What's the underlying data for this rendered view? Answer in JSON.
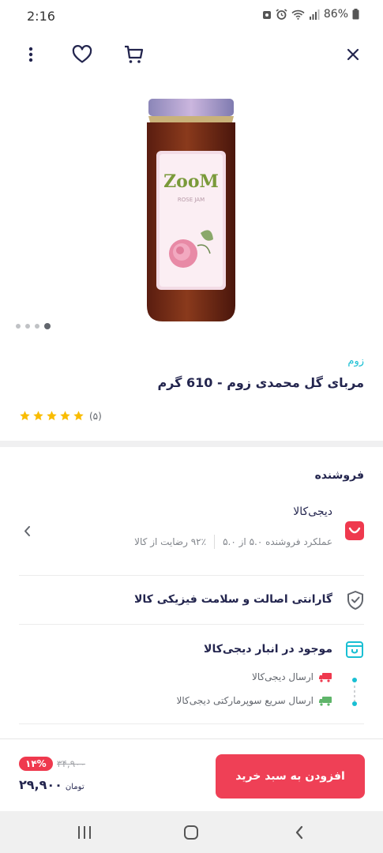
{
  "status_bar": {
    "time": "2:16",
    "battery": "86%"
  },
  "product": {
    "brand": "زوم",
    "title": "مربای گل محمدی زوم - 610 گرم",
    "rating_count": "(۵)",
    "rating_stars": 5,
    "jar_label_brand": "ZooM"
  },
  "gallery": {
    "image_count": 4,
    "active_index": 3
  },
  "seller": {
    "header": "فروشنده",
    "name": "دیجی‌کالا",
    "performance": "عملکرد فروشنده ۵.۰ از ۵.۰",
    "satisfaction": "۹۲٪ رضایت از کالا"
  },
  "guarantee": {
    "text": "گارانتی اصالت و سلامت فیزیکی کالا"
  },
  "stock": {
    "title": "موجود در انبار دیجی‌کالا",
    "ship_1": "ارسال دیجی‌کالا",
    "ship_2": "ارسال سریع سوپرمارکتی دیجی‌کالا"
  },
  "buy": {
    "add_to_cart": "افزودن به سبد خرید",
    "discount": "۱۴%",
    "old_price": "۳۴,۹۰۰",
    "price": "۲۹,۹۰۰",
    "currency": "تومان"
  },
  "colors": {
    "accent": "#ef4056",
    "brand_link": "#19bfd3",
    "star": "#f9bc00"
  }
}
